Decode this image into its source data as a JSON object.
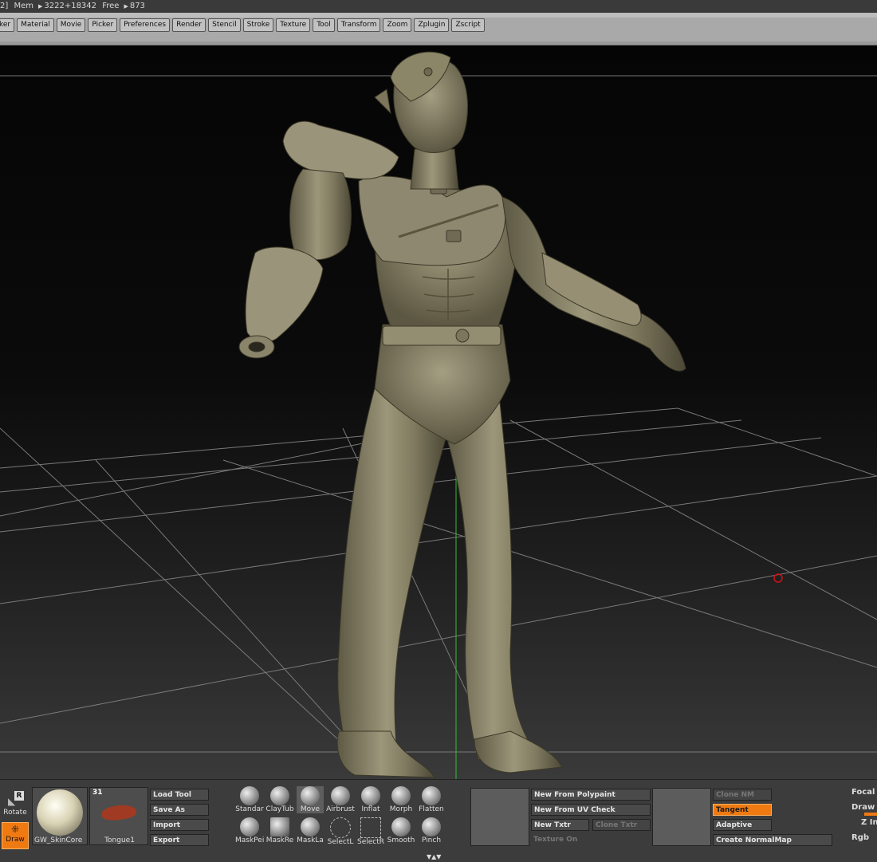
{
  "title_bar": {
    "prefix": "2]",
    "mem_label": "Mem",
    "mem_value": "3222+18342",
    "free_label": "Free",
    "free_value": "873"
  },
  "menu": {
    "items": [
      "ker",
      "Material",
      "Movie",
      "Picker",
      "Preferences",
      "Render",
      "Stencil",
      "Stroke",
      "Texture",
      "Tool",
      "Transform",
      "Zoom",
      "Zplugin",
      "Zscript"
    ]
  },
  "left_tools": {
    "rotate_label": "Rotate",
    "rotate_key": "R",
    "draw_label": "Draw"
  },
  "material": {
    "name": "GW_SkinCore"
  },
  "tool_thumb": {
    "name": "Tongue1",
    "count": "31"
  },
  "tool_buttons": [
    "Load Tool",
    "Save As",
    "Import",
    "Export"
  ],
  "brushes_row1": [
    "Standar",
    "ClayTub",
    "Move",
    "Airbrust",
    "Inflat",
    "Morph",
    "Flatten"
  ],
  "brushes_row2": [
    "MaskPei",
    "MaskRe",
    "MaskLa",
    "SelectL",
    "SelectR",
    "Smooth",
    "Pinch"
  ],
  "selected_brush": "Move",
  "texture_buttons": {
    "new_from_polypaint": "New From Polypaint",
    "new_from_uv_check": "New From UV Check",
    "new_txtr": "New Txtr",
    "clone_txtr": "Clone Txtr",
    "texture_on": "Texture On"
  },
  "normal_buttons": {
    "clone_nm": "Clone NM",
    "tangent": "Tangent",
    "adaptive": "Adaptive",
    "create_normalmap": "Create NormalMap"
  },
  "right_panel": {
    "focal": "Focal",
    "draw": "Draw",
    "z_intensity": "Z In",
    "rgb": "Rgb"
  },
  "colors": {
    "accent": "#f07a12",
    "model": "#8a8466"
  }
}
